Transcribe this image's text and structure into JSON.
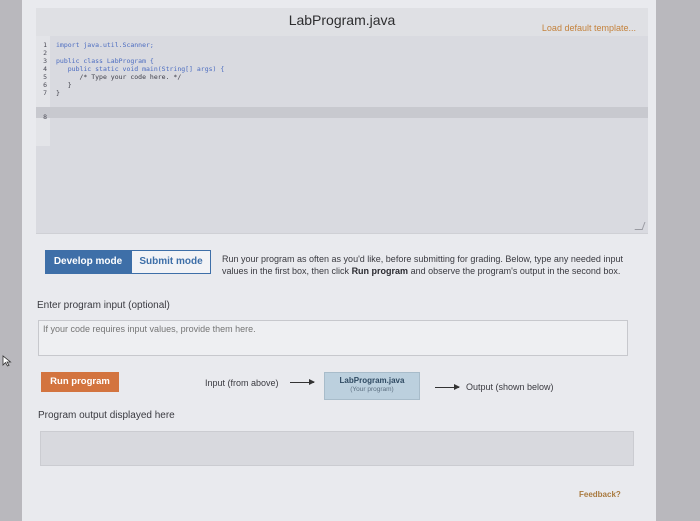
{
  "header": {
    "file_title": "LabProgram.java",
    "load_template": "Load default template..."
  },
  "editor": {
    "line_numbers": [
      "1",
      "2",
      "3",
      "4",
      "5",
      "6",
      "7",
      "8"
    ],
    "lines": [
      "import java.util.Scanner;",
      "",
      "public class LabProgram {",
      "   public static void main(String[] args) {",
      "      /* Type your code here. */",
      "   }",
      "}",
      ""
    ]
  },
  "modes": {
    "develop": "Develop mode",
    "submit": "Submit mode"
  },
  "instructions": {
    "part1": "Run your program as often as you'd like, before submitting for grading. Below, type any needed input values in the first box, then click ",
    "run_program_bold": "Run program",
    "part2": " and observe the program's output in the second box."
  },
  "program_input": {
    "label": "Enter program input (optional)",
    "placeholder": "If your code requires input values, provide them here."
  },
  "run_button": "Run program",
  "flow": {
    "input_label": "Input (from above)",
    "program_name": "LabProgram.java",
    "program_sub": "(Your program)",
    "output_label": "Output (shown below)"
  },
  "output": {
    "label": "Program output displayed here"
  },
  "feedback": "Feedback?",
  "colors": {
    "accent_blue": "#3e6fa8",
    "run_orange": "#d3743f",
    "program_box": "#bcd0de"
  }
}
